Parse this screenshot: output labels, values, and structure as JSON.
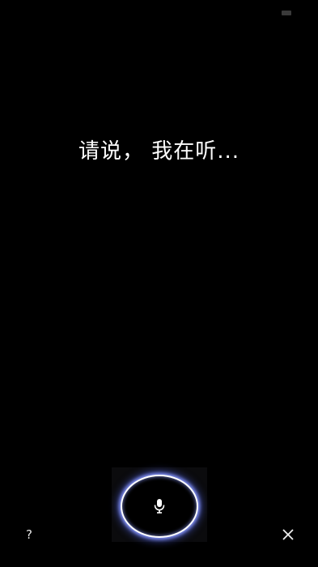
{
  "status_bar": {
    "battery_icon": "battery-icon"
  },
  "main": {
    "prompt_text": "请说， 我在听..."
  },
  "controls": {
    "help_label": "?",
    "mic_icon": "microphone-icon",
    "close_icon": "close-icon"
  },
  "colors": {
    "background": "#000000",
    "text": "#ffffff",
    "mic_glow": "#8c9bff"
  }
}
